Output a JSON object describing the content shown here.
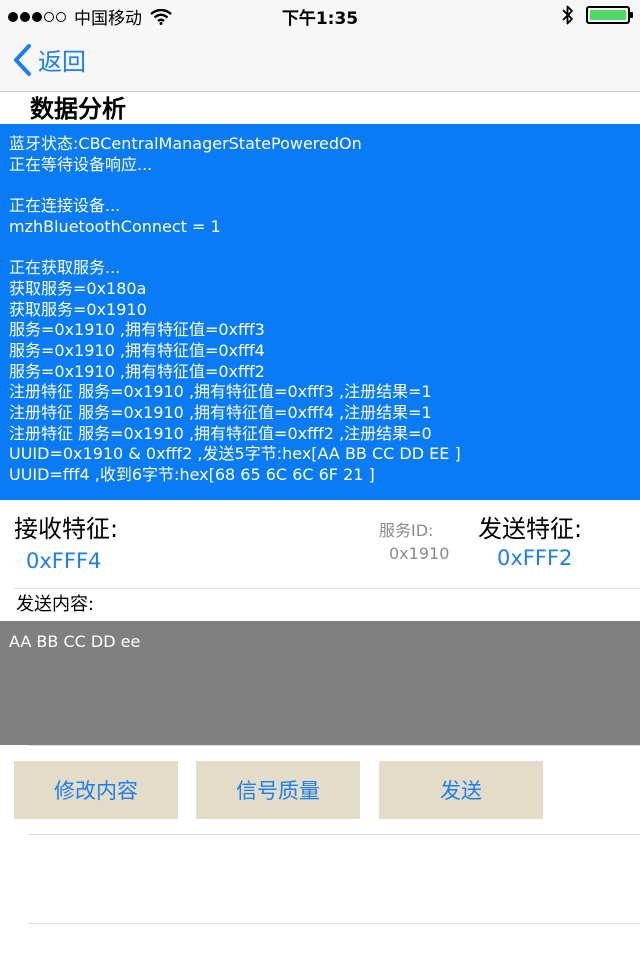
{
  "status_bar": {
    "carrier": "中国移动",
    "time": "下午1:35"
  },
  "nav": {
    "back_label": "返回"
  },
  "section_title": "数据分析",
  "log_lines": [
    "蓝牙状态:CBCentralManagerStatePoweredOn",
    "正在等待设备响应...",
    "",
    "正在连接设备...",
    "mzhBluetoothConnect = 1",
    "",
    "正在获取服务...",
    "获取服务=0x180a",
    "获取服务=0x1910",
    "服务=0x1910 ,拥有特征值=0xfff3",
    "服务=0x1910 ,拥有特征值=0xfff4",
    "服务=0x1910 ,拥有特征值=0xfff2",
    "注册特征 服务=0x1910 ,拥有特征值=0xfff3 ,注册结果=1",
    "注册特征 服务=0x1910 ,拥有特征值=0xfff4 ,注册结果=1",
    "注册特征 服务=0x1910 ,拥有特征值=0xfff2 ,注册结果=0",
    "UUID=0x1910 & 0xfff2 ,发送5字节:hex[AA BB CC DD EE ]",
    "UUID=fff4 ,收到6字节:hex[68 65 6C 6C 6F 21 ]"
  ],
  "receive": {
    "label": "接收特征:",
    "value": "0xFFF4"
  },
  "service": {
    "label": "服务ID:",
    "value": "0x1910"
  },
  "send_char": {
    "label": "发送特征:",
    "value": "0xFFF2"
  },
  "send_content": {
    "label": "发送内容:",
    "value": "AA BB CC DD ee"
  },
  "buttons": {
    "modify": "修改内容",
    "signal": "信号质量",
    "send": "发送"
  },
  "colors": {
    "accent": "#1a7ef5",
    "log_background": "#0a7bf7",
    "textarea_background": "#808080",
    "button_background": "#e3dcc6",
    "battery": "#4cd964"
  },
  "icons": {
    "signal": "signal-dots-icon",
    "wifi": "wifi-icon",
    "bluetooth": "bluetooth-icon",
    "battery": "battery-icon",
    "back": "chevron-left-icon"
  },
  "signal_strength": {
    "bars_filled": 3,
    "bars_total": 5
  },
  "battery_level": 1.0
}
